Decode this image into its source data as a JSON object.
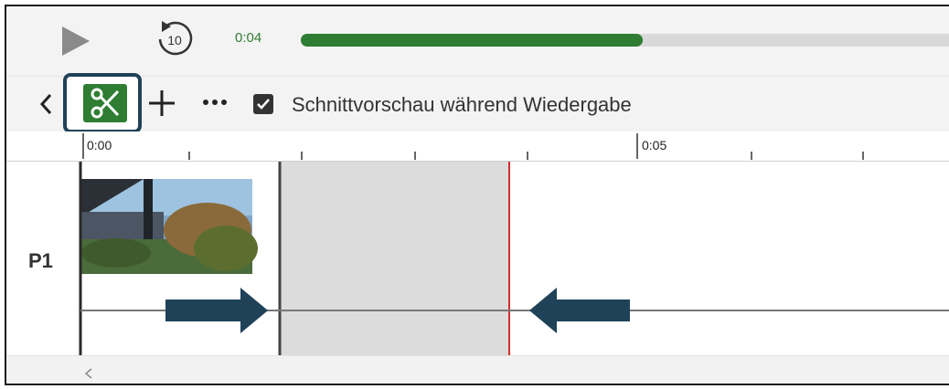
{
  "transport": {
    "current_time": "0:04",
    "progress_fraction": 0.505,
    "replay_seconds": "10"
  },
  "toolbar": {
    "checkbox_checked": true,
    "checkbox_label": "Schnittvorschau während Wiedergabe",
    "icons": [
      "chevron-left-icon",
      "scissors-icon",
      "plus-icon",
      "more-icon",
      "checkbox-checked-icon"
    ]
  },
  "ruler": {
    "labels": [
      "0:00",
      "0:05"
    ]
  },
  "track": {
    "label": "P1"
  },
  "colors": {
    "accent": "#2e7d32",
    "highlight_frame": "#1f4258",
    "arrow": "#1f4258",
    "playhead": "#d32f2f",
    "cut_region": "#dcdcdc"
  }
}
